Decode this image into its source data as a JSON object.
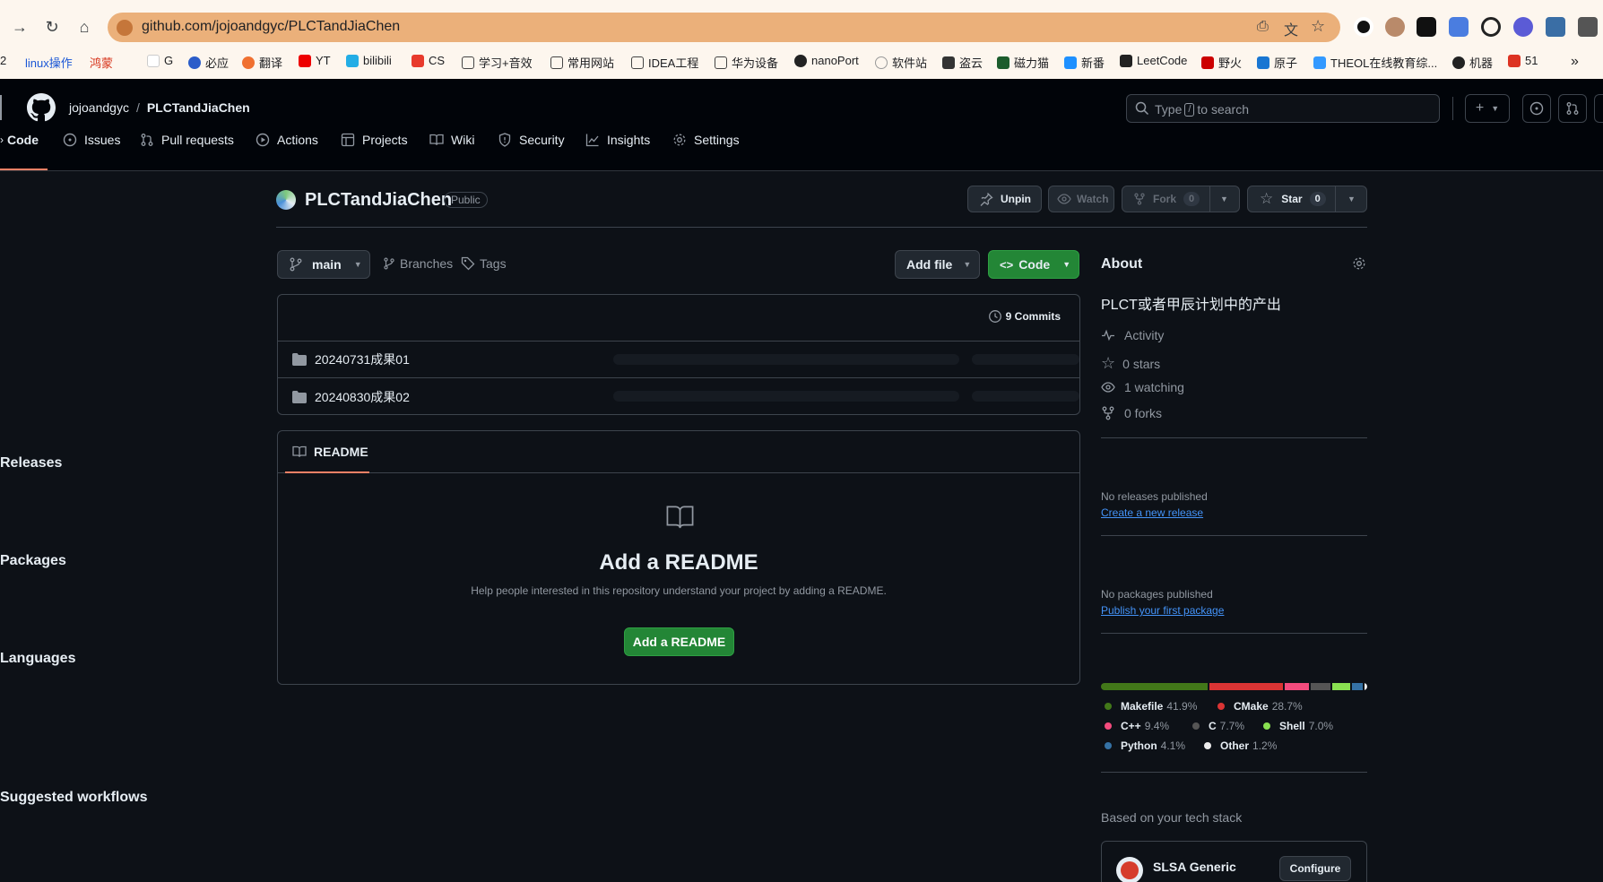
{
  "browser": {
    "url": "github.com/jojoandgyc/PLCTandJiaChen",
    "bookmarks": [
      "2",
      "linux操作",
      "鸿蒙",
      "G",
      "必应",
      "翻译",
      "YT",
      "bilibili",
      "CS",
      "学习+音效",
      "常用网站",
      "IDEA工程",
      "华为设备",
      "nanoPort",
      "软件站",
      "盗云",
      "磁力猫",
      "新番",
      "LeetCode",
      "野火",
      "原子",
      "THEOL在线教育综...",
      "机器",
      "51"
    ]
  },
  "header": {
    "owner": "jojoandgyc",
    "separator": "/",
    "repo": "PLCTandJiaChen",
    "search_placeholder_pre": "Type",
    "search_key": "/",
    "search_placeholder_post": "to search",
    "plus": "+"
  },
  "tabs": [
    {
      "label": "Code",
      "icon": "code-icon",
      "active": true
    },
    {
      "label": "Issues",
      "icon": "issue-icon"
    },
    {
      "label": "Pull requests",
      "icon": "pull-request-icon"
    },
    {
      "label": "Actions",
      "icon": "play-icon"
    },
    {
      "label": "Projects",
      "icon": "table-icon"
    },
    {
      "label": "Wiki",
      "icon": "book-icon"
    },
    {
      "label": "Security",
      "icon": "shield-icon"
    },
    {
      "label": "Insights",
      "icon": "graph-icon"
    },
    {
      "label": "Settings",
      "icon": "gear-icon"
    }
  ],
  "repo": {
    "name": "PLCTandJiaChen",
    "visibility": "Public",
    "unpin": "Unpin",
    "watch": "Watch",
    "fork": "Fork",
    "fork_count": "0",
    "star": "Star",
    "star_count": "0"
  },
  "toolbar": {
    "branch": "main",
    "branches": "Branches",
    "tags": "Tags",
    "add_file": "Add file",
    "code": "Code"
  },
  "files": {
    "commits": "9 Commits",
    "items": [
      "20240731成果01",
      "20240830成果02"
    ]
  },
  "readme": {
    "tab": "README",
    "title": "Add a README",
    "description": "Help people interested in this repository understand your project by adding a README.",
    "button": "Add a README"
  },
  "about": {
    "title": "About",
    "description": "PLCT或者甲辰计划中的产出",
    "activity": "Activity",
    "stars": "0 stars",
    "watching": "1 watching",
    "forks": "0 forks"
  },
  "releases": {
    "title": "Releases",
    "none": "No releases published",
    "link": "Create a new release"
  },
  "packages": {
    "title": "Packages",
    "none": "No packages published",
    "link": "Publish your first package"
  },
  "languages": {
    "title": "Languages",
    "items": [
      {
        "name": "Makefile",
        "percent": "41.9%",
        "value": 41.9,
        "color": "#427819"
      },
      {
        "name": "CMake",
        "percent": "28.7%",
        "value": 28.7,
        "color": "#DA3434"
      },
      {
        "name": "C++",
        "percent": "9.4%",
        "value": 9.4,
        "color": "#f34b7d"
      },
      {
        "name": "C",
        "percent": "7.7%",
        "value": 7.7,
        "color": "#555555"
      },
      {
        "name": "Shell",
        "percent": "7.0%",
        "value": 7.0,
        "color": "#89e051"
      },
      {
        "name": "Python",
        "percent": "4.1%",
        "value": 4.1,
        "color": "#3572A5"
      },
      {
        "name": "Other",
        "percent": "1.2%",
        "value": 1.2,
        "color": "#ededed"
      }
    ]
  },
  "workflows": {
    "title": "Suggested workflows",
    "subtitle": "Based on your tech stack",
    "card_title": "SLSA Generic",
    "configure": "Configure"
  }
}
